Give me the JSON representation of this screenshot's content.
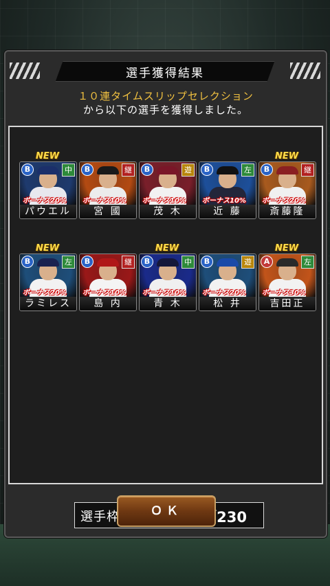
{
  "dialog": {
    "title": "選手獲得結果",
    "subtitle_line1": "１０連タイムスリップセレクション",
    "subtitle_line2": "から以下の選手を獲得しました。"
  },
  "players": [
    {
      "name": "パウエル",
      "rank": "B",
      "position": "中",
      "bonus": "ボーナス20%",
      "is_new": true,
      "new_label": "NEW",
      "bg": "#1e3a6e",
      "uniform": "#e8e8ee",
      "cap": "#1b2f6a",
      "pos_color": "#2d8a3a"
    },
    {
      "name": "宮 國",
      "rank": "B",
      "position": "継",
      "bonus": "ボーナス10%",
      "is_new": false,
      "new_label": "",
      "bg": "#b34a12",
      "uniform": "#ececec",
      "cap": "#1a1a1a",
      "pos_color": "#b32020"
    },
    {
      "name": "茂 木",
      "rank": "B",
      "position": "遊",
      "bonus": "ボーナス10%",
      "is_new": false,
      "new_label": "",
      "bg": "#7a1f2a",
      "uniform": "#f2f2f2",
      "cap": "#7a1628",
      "pos_color": "#b8860b"
    },
    {
      "name": "近 藤",
      "rank": "B",
      "position": "左",
      "bonus": "ボーナス10%",
      "is_new": false,
      "new_label": "",
      "bg": "#1d4f9a",
      "uniform": "#23263a",
      "cap": "#111111",
      "pos_color": "#2d8a3a"
    },
    {
      "name": "斎藤隆",
      "rank": "B",
      "position": "継",
      "bonus": "ボーナス20%",
      "is_new": true,
      "new_label": "NEW",
      "bg": "#a85a1e",
      "uniform": "#f0f0f0",
      "cap": "#8a1f22",
      "pos_color": "#b32020"
    },
    {
      "name": "ラミレス",
      "rank": "B",
      "position": "左",
      "bonus": "ボーナス20%",
      "is_new": true,
      "new_label": "NEW",
      "bg": "#1e4e7a",
      "uniform": "#f2f2f2",
      "cap": "#1a2250",
      "pos_color": "#2d8a3a"
    },
    {
      "name": "島 内",
      "rank": "B",
      "position": "継",
      "bonus": "ボーナス10%",
      "is_new": false,
      "new_label": "",
      "bg": "#9a1818",
      "uniform": "#f4f4f4",
      "cap": "#b01818",
      "pos_color": "#b32020"
    },
    {
      "name": "青 木",
      "rank": "B",
      "position": "中",
      "bonus": "ボーナス10%",
      "is_new": true,
      "new_label": "NEW",
      "bg": "#1a2a8a",
      "uniform": "#f0f0f0",
      "cap": "#15173a",
      "pos_color": "#2d8a3a"
    },
    {
      "name": "松 井",
      "rank": "B",
      "position": "遊",
      "bonus": "ボーナス20%",
      "is_new": false,
      "new_label": "",
      "bg": "#1e4e7a",
      "uniform": "#f2f2f2",
      "cap": "#1a4aa8",
      "pos_color": "#b8860b"
    },
    {
      "name": "吉田正",
      "rank": "A",
      "position": "左",
      "bonus": "ボーナス30%",
      "is_new": true,
      "new_label": "NEW",
      "bg": "#c2541a",
      "uniform": "#f2f2f2",
      "cap": "#2a2a2a",
      "pos_color": "#2d8a3a"
    }
  ],
  "rank_colors": {
    "A": "#c23a3a",
    "B": "#2a63c6"
  },
  "roster": {
    "label": "選手枠：",
    "value": "207／230"
  },
  "ok_button": {
    "label": "ＯＫ"
  }
}
